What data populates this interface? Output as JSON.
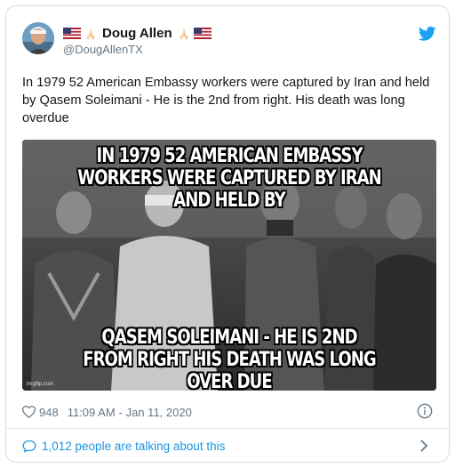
{
  "user": {
    "display_name": "Doug Allen",
    "handle": "@DougAllenTX",
    "name_prefix_emoji": [
      "flag-us-icon",
      "praying-hands-icon"
    ],
    "name_suffix_emoji": [
      "praying-hands-icon",
      "flag-us-icon"
    ]
  },
  "tweet": {
    "text": "In 1979 52 American Embassy workers were captured by Iran and held by Qasem Soleimani - He is the 2nd from right. His death was long overdue"
  },
  "media": {
    "top_caption_line1": "IN 1979 52 AMERICAN EMBASSY",
    "top_caption_line2": "WORKERS WERE CAPTURED BY IRAN  AND HELD BY",
    "bottom_caption_line1": "QASEM SOLEIMANI - HE IS 2ND",
    "bottom_caption_line2": "FROM RIGHT HIS DEATH WAS LONG OVER DUE",
    "watermark": "imgflip.com"
  },
  "meta": {
    "likes": "948",
    "time": "11:09 AM",
    "date": "- Jan 11, 2020"
  },
  "conversation": {
    "label": "1,012 people are talking about this"
  },
  "colors": {
    "twitter_blue": "#1da1f2",
    "link_blue": "#1b95e0",
    "muted": "#657786",
    "text": "#14171a"
  },
  "icons": {
    "brand": "twitter-bird-icon",
    "like": "heart-icon",
    "info": "info-icon",
    "conversation": "speech-bubble-icon",
    "more": "chevron-right-icon"
  }
}
